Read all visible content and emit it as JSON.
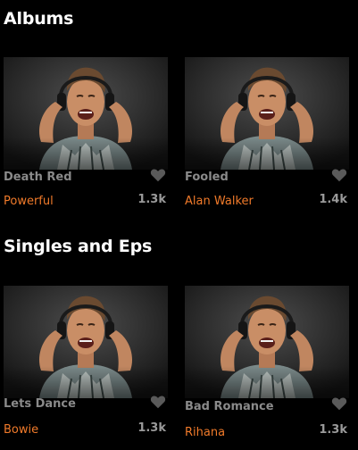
{
  "albums": {
    "heading": "Albums",
    "items": [
      {
        "title": "Death Red",
        "artist": "Powerful",
        "count": "1.3k",
        "icon": "heart-icon"
      },
      {
        "title": "Fooled",
        "artist": "Alan Walker",
        "count": "1.4k",
        "icon": "heart-icon"
      }
    ]
  },
  "singles": {
    "heading": "Singles and Eps",
    "items": [
      {
        "title": "Lets Dance",
        "artist": "Bowie",
        "count": "1.3k",
        "icon": "heart-icon"
      },
      {
        "title": "Bad Romance",
        "artist": "Rihana",
        "count": "1.3k",
        "icon": "heart-icon"
      }
    ]
  },
  "colors": {
    "background": "#000000",
    "accent": "#f07a2a",
    "muted_text": "#8a8a8a",
    "heart": "#5a5a5a"
  }
}
